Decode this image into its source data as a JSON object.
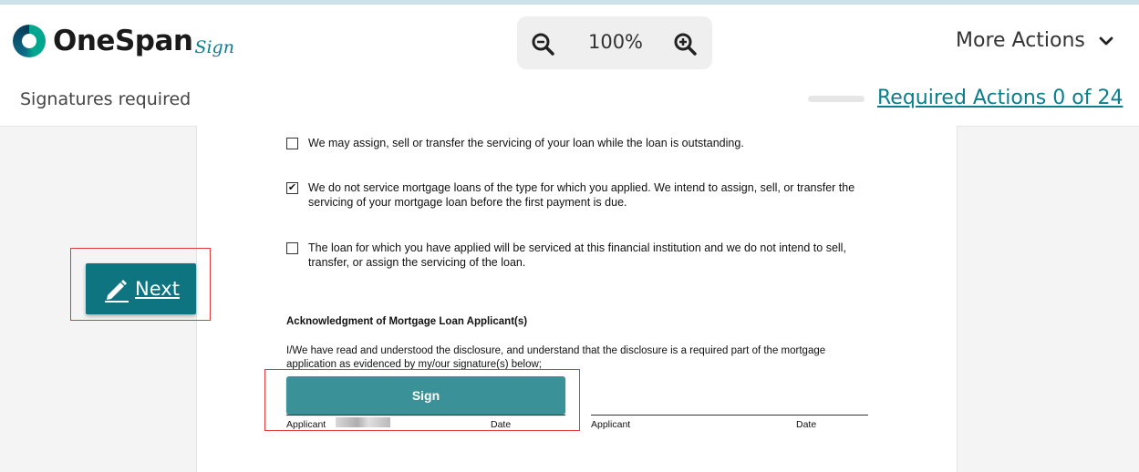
{
  "app": {
    "brand": "OneSpan",
    "brand_sub": "Sign",
    "brand_colors": {
      "teal": "#00a78e",
      "dark": "#0a3a57"
    }
  },
  "toolbar": {
    "zoom_level": "100%",
    "zoom_out_icon": "zoom-out-icon",
    "zoom_in_icon": "zoom-in-icon",
    "more_actions_label": "More Actions",
    "more_actions_icon": "chevron-down-icon"
  },
  "status_bar": {
    "title": "Signatures required",
    "progress": 0,
    "required_actions_label": "Required Actions 0 of 24"
  },
  "document": {
    "options": [
      {
        "checked": false,
        "text": "We may assign, sell or transfer the servicing of your loan while the loan is outstanding."
      },
      {
        "checked": true,
        "text": "We do not service mortgage loans of the type for which you applied. We intend to assign, sell, or transfer the servicing of your mortgage loan before the first payment is due."
      },
      {
        "checked": false,
        "text": "The loan for which you have applied will be serviced at this financial institution and we do not intend to sell, transfer, or assign the servicing of the loan."
      }
    ],
    "ack_title": "Acknowledgment of Mortgage Loan Applicant(s)",
    "ack_text": "I/We have read and understood the disclosure, and understand that the disclosure is a required part of the mortgage application as evidenced by my/our signature(s) below;",
    "sign_button": "Sign",
    "signature_labels": {
      "applicant_1": "Applicant",
      "date_1": "Date",
      "applicant_2": "Applicant",
      "date_2": "Date"
    }
  },
  "nav": {
    "next_label": "Next",
    "next_icon": "pencil-icon",
    "button_color": "#0e7480"
  },
  "annotations": {
    "highlight_color": "#e23a3a"
  },
  "sign_color": "#3a9198",
  "link_color": "#0a7e8c"
}
